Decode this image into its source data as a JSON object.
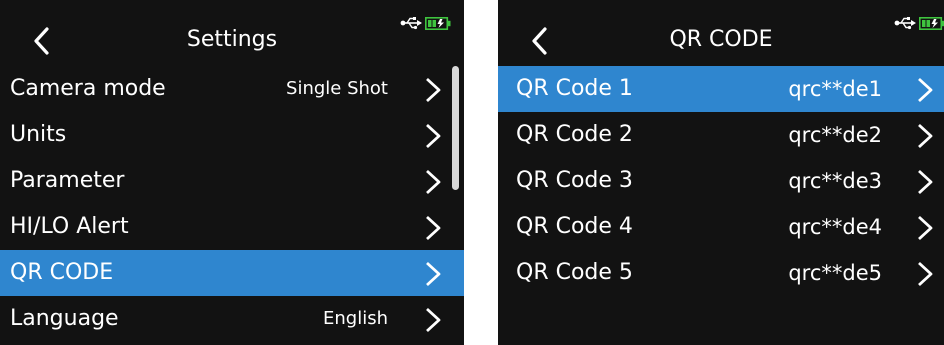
{
  "left_screen": {
    "title": "Settings",
    "rows": [
      {
        "label": "Camera mode",
        "value": "Single Shot",
        "selected": false
      },
      {
        "label": "Units",
        "value": "",
        "selected": false
      },
      {
        "label": "Parameter",
        "value": "",
        "selected": false
      },
      {
        "label": "HI/LO Alert",
        "value": "",
        "selected": false
      },
      {
        "label": "QR CODE",
        "value": "",
        "selected": true
      },
      {
        "label": "Language",
        "value": "English",
        "selected": false
      }
    ]
  },
  "right_screen": {
    "title": "QR CODE",
    "rows": [
      {
        "label": "QR Code 1",
        "value": "qrc**de1",
        "selected": true
      },
      {
        "label": "QR Code 2",
        "value": "qrc**de2",
        "selected": false
      },
      {
        "label": "QR Code 3",
        "value": "qrc**de3",
        "selected": false
      },
      {
        "label": "QR Code 4",
        "value": "qrc**de4",
        "selected": false
      },
      {
        "label": "QR Code 5",
        "value": "qrc**de5",
        "selected": false
      }
    ]
  },
  "icons": {
    "back": "chevron-left-icon",
    "row_arrow": "chevron-right-icon",
    "usb": "usb-icon",
    "battery": "battery-charging-icon"
  },
  "colors": {
    "background": "#121212",
    "selected_row": "#2f86cf",
    "text": "#ffffff",
    "battery": "#3fc43f",
    "scrollbar": "#d8d8d8"
  }
}
